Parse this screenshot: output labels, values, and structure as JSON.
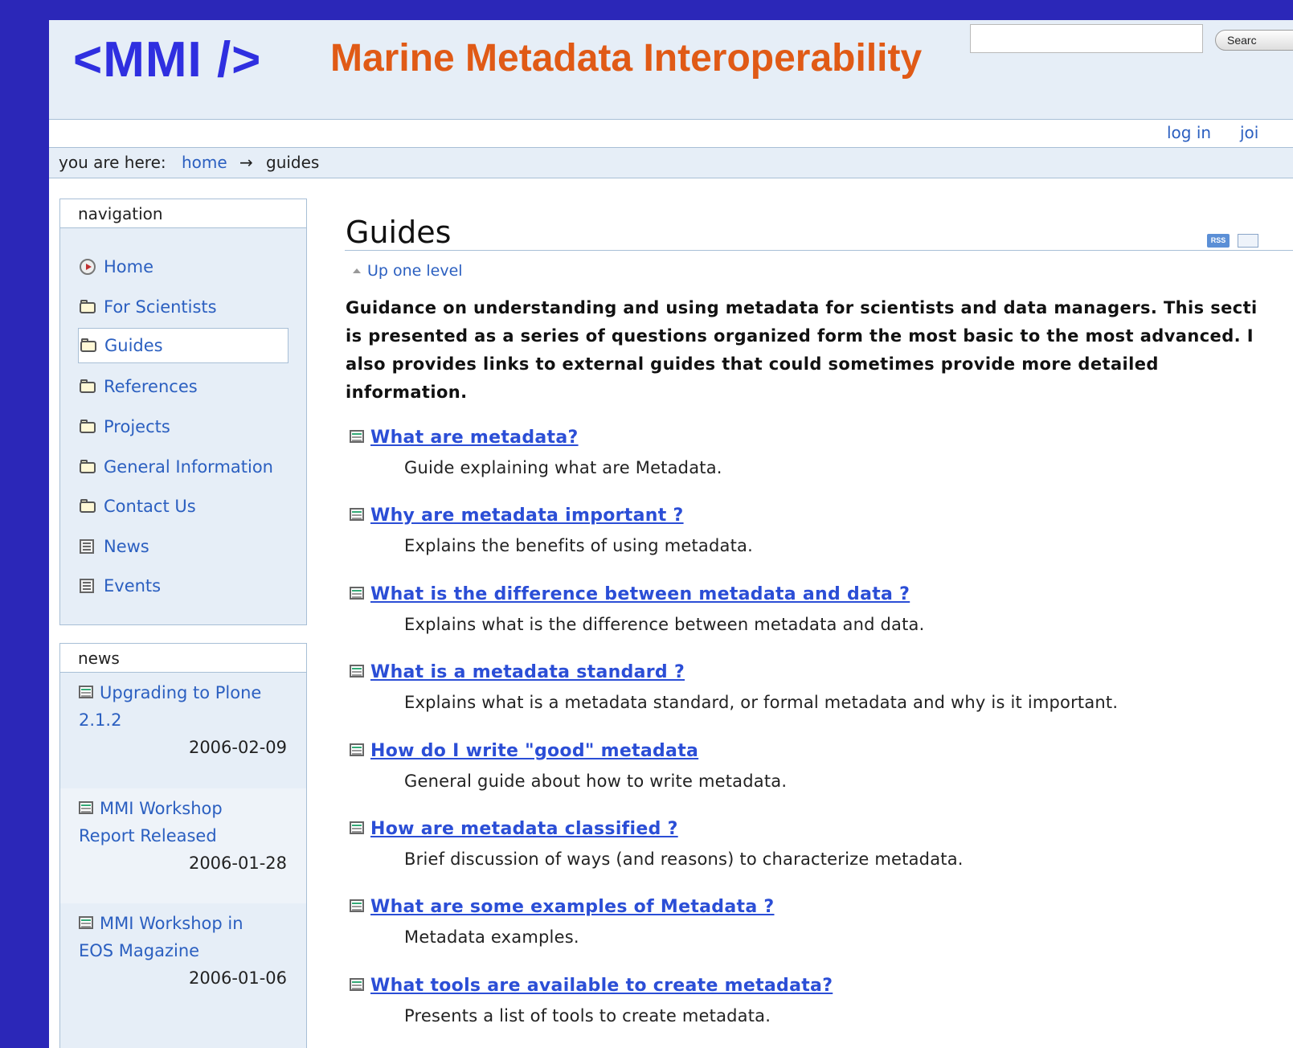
{
  "header": {
    "logo": "<MMI />",
    "site_title": "Marine Metadata Interoperability",
    "search_placeholder": "",
    "search_button": "Searc"
  },
  "personal_bar": {
    "login": "log in",
    "join": "joi"
  },
  "breadcrumb": {
    "prefix": "you are here:",
    "home": "home",
    "arrow": "→",
    "current": "guides"
  },
  "navigation": {
    "title": "navigation",
    "items": [
      {
        "label": "Home",
        "icon": "home-icon"
      },
      {
        "label": "For Scientists",
        "icon": "folder-icon"
      },
      {
        "label": "Guides",
        "icon": "folder-icon",
        "selected": true
      },
      {
        "label": "References",
        "icon": "folder-icon"
      },
      {
        "label": "Projects",
        "icon": "folder-icon"
      },
      {
        "label": "General Information",
        "icon": "folder-icon"
      },
      {
        "label": "Contact Us",
        "icon": "folder-icon"
      },
      {
        "label": "News",
        "icon": "news-icon"
      },
      {
        "label": "Events",
        "icon": "news-icon"
      }
    ]
  },
  "news": {
    "title": "news",
    "items": [
      {
        "line1": "Upgrading to Plone",
        "line2": "2.1.2",
        "date": "2006-02-09"
      },
      {
        "line1": "MMI Workshop",
        "line2": "Report Released",
        "date": "2006-01-28"
      },
      {
        "line1": "MMI Workshop in",
        "line2": "EOS Magazine",
        "date": "2006-01-06"
      }
    ]
  },
  "main": {
    "title": "Guides",
    "rss_label": "RSS",
    "up_one_level": "Up one level",
    "description": "Guidance on understanding and using metadata for scientists and data managers. This secti is presented as a series of questions organized form the most basic to the most advanced. I also provides links to external guides that could sometimes provide more detailed information.",
    "description_lines": [
      "Guidance on understanding and using metadata for scientists and data managers. This secti",
      "is presented as a series of questions organized form the most basic to the most advanced. I",
      "also provides links to external guides that could sometimes provide more detailed",
      "information."
    ],
    "items": [
      {
        "title": "What are metadata?",
        "desc": "Guide explaining what are Metadata."
      },
      {
        "title": "Why are metadata important ?",
        "desc": "Explains the benefits of using metadata."
      },
      {
        "title": "What is the difference between metadata and data ?",
        "desc": "Explains what is the difference between metadata and data."
      },
      {
        "title": "What is a metadata standard ?",
        "desc": "Explains what is a metadata standard, or formal metadata and why is it important."
      },
      {
        "title": "How do I write \"good\" metadata",
        "desc": "General guide about how to write metadata."
      },
      {
        "title": "How are metadata classified ?",
        "desc": "Brief discussion of ways (and reasons) to characterize metadata."
      },
      {
        "title": "What are some examples of Metadata ?",
        "desc": "Metadata examples."
      },
      {
        "title": "What tools are available to create metadata?",
        "desc": "Presents a list of tools to create metadata."
      }
    ]
  }
}
